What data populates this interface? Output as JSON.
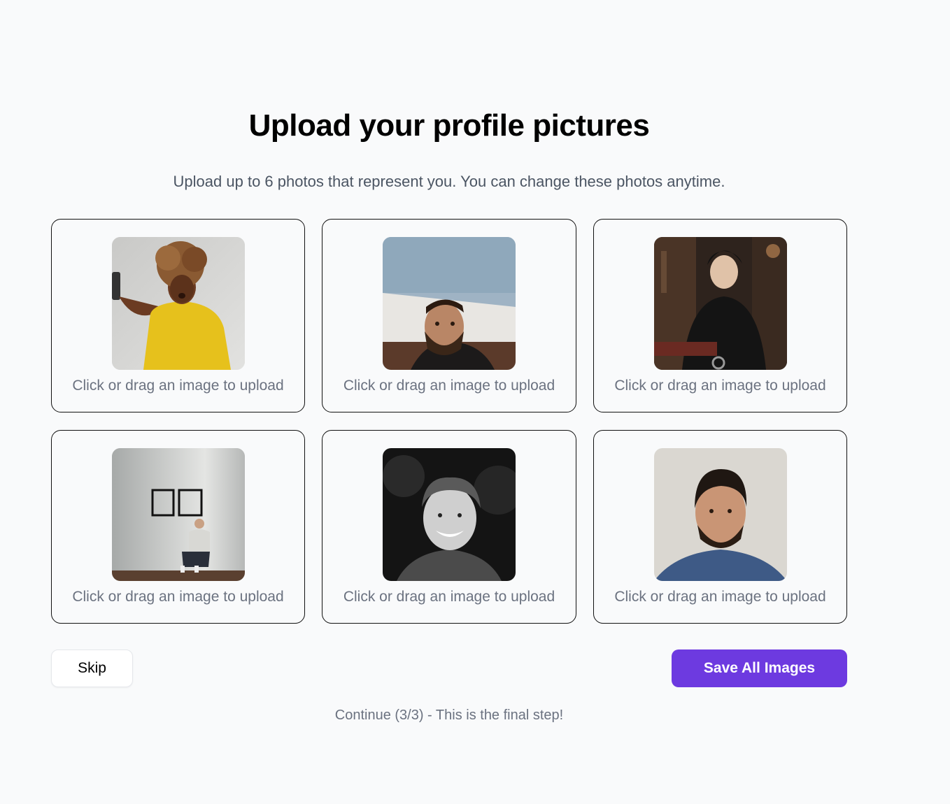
{
  "header": {
    "title": "Upload your profile pictures",
    "subtitle": "Upload up to 6 photos that represent you. You can change these photos anytime."
  },
  "slots": [
    {
      "label": "Click or drag an image to upload",
      "photo": "woman-selfie-yellow-shirt"
    },
    {
      "label": "Click or drag an image to upload",
      "photo": "bearded-man-reclining"
    },
    {
      "label": "Click or drag an image to upload",
      "photo": "man-leather-jacket-chair"
    },
    {
      "label": "Click or drag an image to upload",
      "photo": "man-sitting-gray-room"
    },
    {
      "label": "Click or drag an image to upload",
      "photo": "smiling-man-black-white"
    },
    {
      "label": "Click or drag an image to upload",
      "photo": "bearded-man-blue-shirt"
    }
  ],
  "actions": {
    "skip_label": "Skip",
    "save_label": "Save All Images"
  },
  "footer": {
    "continue_text": "Continue (3/3) - This is the final step!"
  },
  "colors": {
    "accent": "#6d3ae0",
    "background": "#f9fafb",
    "muted_text": "#6b7280"
  }
}
